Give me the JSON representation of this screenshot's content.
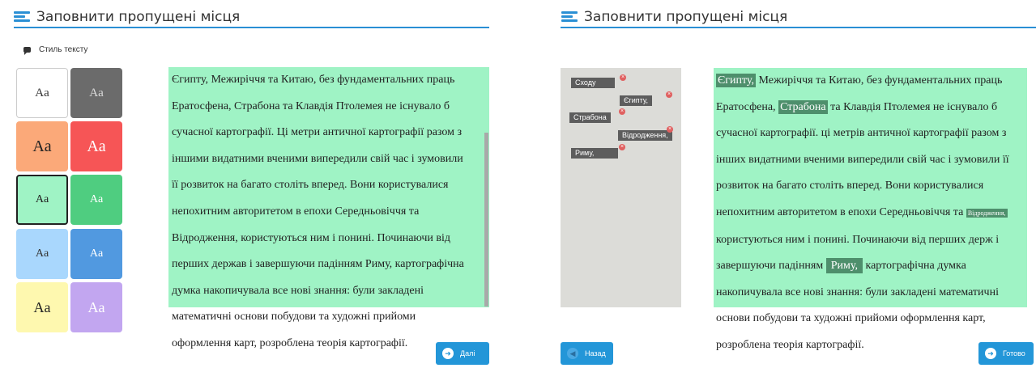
{
  "left": {
    "header_title": "Заповнити пропущені місця",
    "style_label": "Стиль тексту",
    "swatches": [
      {
        "label": "Aa",
        "bg": "#ffffff",
        "fg": "#333333"
      },
      {
        "label": "Aa",
        "bg": "#6b6b6b",
        "fg": "#dddddd"
      },
      {
        "label": "Aa",
        "bg": "#fba979",
        "fg": "#222222"
      },
      {
        "label": "Aa",
        "bg": "#f65556",
        "fg": "#ffffff"
      },
      {
        "label": "Aa",
        "bg": "#9ff3c5",
        "fg": "#222222"
      },
      {
        "label": "Aa",
        "bg": "#4fcd80",
        "fg": "#ffffff"
      },
      {
        "label": "Aa",
        "bg": "#a9d7fd",
        "fg": "#333333"
      },
      {
        "label": "Aa",
        "bg": "#5199e0",
        "fg": "#ffffff"
      },
      {
        "label": "Aa",
        "bg": "#fef8af",
        "fg": "#222222"
      },
      {
        "label": "Aa",
        "bg": "#c2a6f0",
        "fg": "#ffffff"
      }
    ],
    "selected_swatch": 4,
    "paragraph_lines": [
      "Єгипту, Межиріччя та Китаю, без фундаментальних праць",
      "Ератосфена, Страбона та Клавдія Птолемея не існувало б",
      "сучасної картографії. Ці метри античної картографії разом з",
      "іншими видатними вченими випередили свій час і зумовили",
      "її розвиток на багато століть вперед. Вони користувалися",
      "непохитним авторитетом в епохи Середньовіччя та",
      "Відродження, користуються ним і понині. Починаючи від",
      "перших держав і завершуючи падінням Риму, картографічна",
      "думка накопичувала все нові знання: були закладені",
      "математичні основи побудови та художні прийоми",
      "оформлення карт, розроблена теорія картографії."
    ],
    "next_button": "Далі"
  },
  "right": {
    "header_title": "Заповнити пропущені місця",
    "word_bank": [
      "Сходу",
      "Єгипту,",
      "Страбона",
      "Відродження,",
      "Риму,"
    ],
    "lines": {
      "l1_blank": "Єгипту,",
      "l1_rest": "Межиріччя та Китаю, без фундаментальних праць",
      "l2_a": "Ератосфена,",
      "l2_blank": "Страбона",
      "l2_b": "та Клавдія Птолемея не існувало б",
      "l3": "сучасної картографії. ці метрів античної картографії разом з",
      "l4": "інших видатними вченими випередили свій час і зумовили її",
      "l5": "розвиток на багато століть вперед. Вони користувалися",
      "l6_a": "непохитним авторитетом в епохи Середньовіччя та",
      "l6_blank": "Відродження,",
      "l7": "користуються ним і понині. Починаючи від перших держ і",
      "l8_a": "завершуючи падінням",
      "l8_blank": "Риму,",
      "l8_b": "картографічна думка",
      "l9": "накопичувала все нові знання: були закладені математичні",
      "l10": "основи побудови та художні прийоми оформлення карт,",
      "l11": "розроблена теорія картографії."
    },
    "back_button": "Назад",
    "done_button": "Готово"
  }
}
